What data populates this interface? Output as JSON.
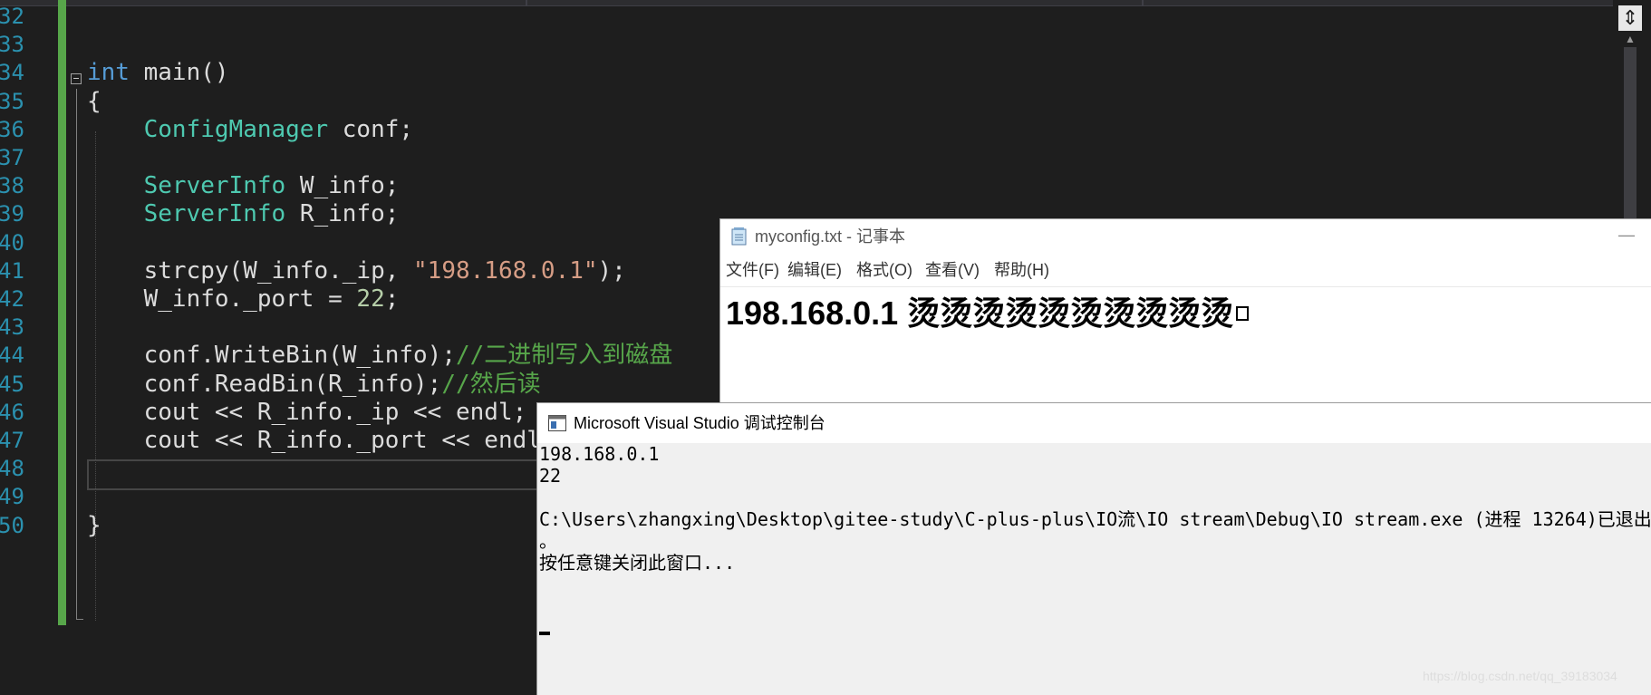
{
  "editor": {
    "line_numbers": [
      "32",
      "33",
      "34",
      "35",
      "36",
      "37",
      "38",
      "39",
      "40",
      "41",
      "42",
      "43",
      "44",
      "45",
      "46",
      "47",
      "48",
      "49",
      "50"
    ],
    "lines": [
      [],
      [],
      [
        {
          "t": "int",
          "c": "kw"
        },
        {
          "t": " main()",
          "c": ""
        }
      ],
      [
        {
          "t": "{",
          "c": ""
        }
      ],
      [
        {
          "t": "    ",
          "c": ""
        },
        {
          "t": "ConfigManager",
          "c": "ty"
        },
        {
          "t": " conf;",
          "c": ""
        }
      ],
      [],
      [
        {
          "t": "    ",
          "c": ""
        },
        {
          "t": "ServerInfo",
          "c": "ty"
        },
        {
          "t": " W_info;",
          "c": ""
        }
      ],
      [
        {
          "t": "    ",
          "c": ""
        },
        {
          "t": "ServerInfo",
          "c": "ty"
        },
        {
          "t": " R_info;",
          "c": ""
        }
      ],
      [],
      [
        {
          "t": "    strcpy(W_info._ip, ",
          "c": ""
        },
        {
          "t": "\"198.168.0.1\"",
          "c": "str"
        },
        {
          "t": ");",
          "c": ""
        }
      ],
      [
        {
          "t": "    W_info._port = ",
          "c": ""
        },
        {
          "t": "22",
          "c": "num"
        },
        {
          "t": ";",
          "c": ""
        }
      ],
      [],
      [
        {
          "t": "    conf.WriteBin(W_info);",
          "c": ""
        },
        {
          "t": "//二进制写入到磁盘",
          "c": "cm"
        }
      ],
      [
        {
          "t": "    conf.ReadBin(R_info);",
          "c": ""
        },
        {
          "t": "//然后读",
          "c": "cm"
        }
      ],
      [
        {
          "t": "    cout << R_info._ip << endl;",
          "c": ""
        }
      ],
      [
        {
          "t": "    cout << R_info._port << endl;",
          "c": ""
        }
      ],
      [],
      [],
      [
        {
          "t": "}",
          "c": ""
        }
      ]
    ]
  },
  "notepad": {
    "title": "myconfig.txt - 记事本",
    "minimize_glyph": "—",
    "menu": [
      "文件(F)",
      "编辑(E)",
      "格式(O)",
      "查看(V)",
      "帮助(H)"
    ],
    "content": "198.168.0.1 烫烫烫烫烫烫烫烫烫烫"
  },
  "console": {
    "title": "Microsoft Visual Studio 调试控制台",
    "lines": [
      "198.168.0.1",
      "22",
      "",
      "C:\\Users\\zhangxing\\Desktop\\gitee-study\\C-plus-plus\\IO流\\IO stream\\Debug\\IO stream.exe (进程 13264)已退出",
      "。",
      "按任意键关闭此窗口..."
    ]
  },
  "watermark": "https://blog.csdn.net/qq_39183034",
  "colors": {
    "editor_bg": "#1e1e1e",
    "keyword": "#569cd6",
    "type": "#4ec9b0",
    "string": "#d69d85",
    "number": "#b5cea8",
    "comment": "#57a64a",
    "line_number": "#2b91af",
    "console_bg": "#f0f0f0"
  }
}
